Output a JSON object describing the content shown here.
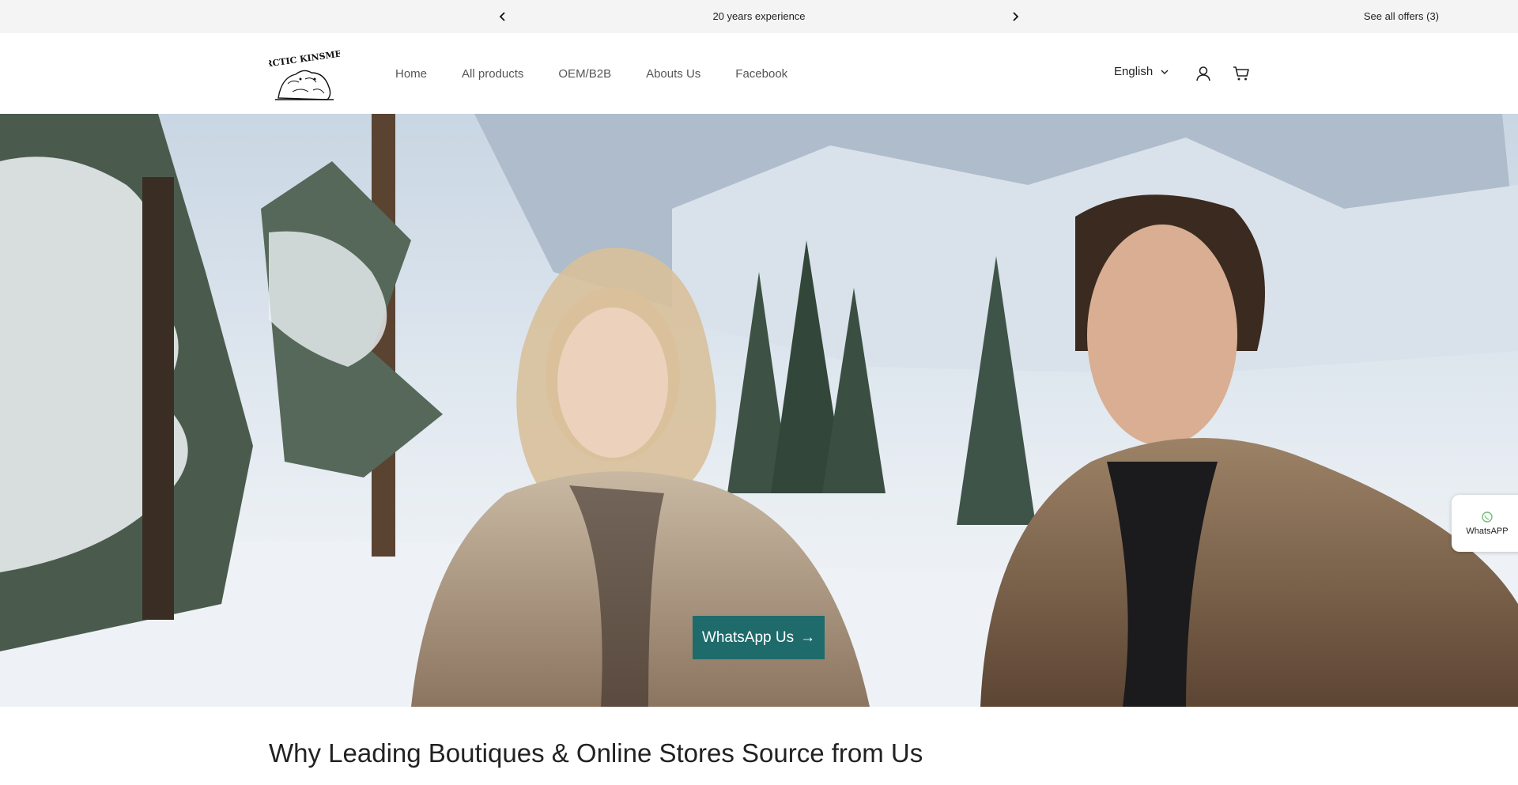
{
  "announcement": {
    "message": "20 years experience",
    "offers_link": "See all offers (3)"
  },
  "header": {
    "logo_text": "ARCTIC KINSMEN",
    "nav": [
      {
        "label": "Home"
      },
      {
        "label": "All products"
      },
      {
        "label": "OEM/B2B"
      },
      {
        "label": "Abouts Us"
      },
      {
        "label": "Facebook"
      }
    ],
    "language": "English"
  },
  "hero": {
    "cta_label": "WhatsApp Us",
    "cta_arrow": "→"
  },
  "side_widget": {
    "label": "WhatsAPP"
  },
  "section": {
    "title": "Why Leading Boutiques & Online Stores Source from Us"
  },
  "colors": {
    "accent": "#1f6b6b",
    "announcement_bg": "#f4f4f4"
  },
  "icons": {
    "prev": "chevron-left-icon",
    "next": "chevron-right-icon",
    "language": "chevron-down-icon",
    "account": "user-icon",
    "cart": "cart-icon"
  }
}
